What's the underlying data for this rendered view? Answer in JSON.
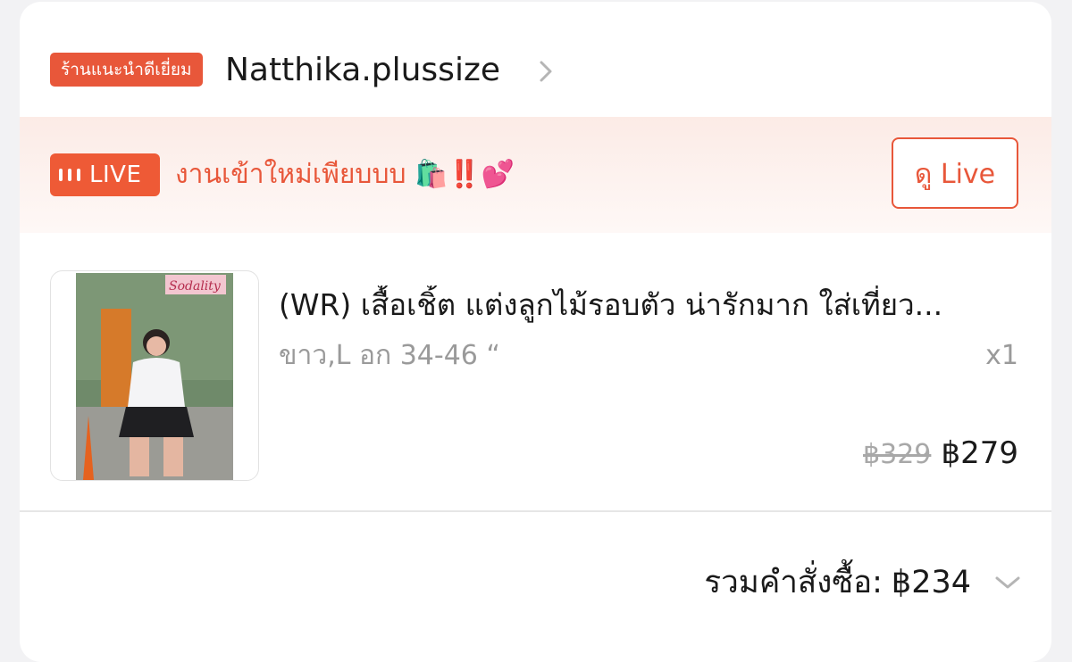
{
  "shop": {
    "badge": "ร้านแนะนำดีเยี่ยม",
    "name": "Natthika.plussize"
  },
  "live": {
    "badge_label": "LIVE",
    "caption": "งานเข้าใหม่เพียบบบ 🛍️‼️💕",
    "watch_button": "ดู Live"
  },
  "product": {
    "title": "(WR) เสื้อเชิ้ต แต่งลูกไม้รอบตัว น่ารักมาก ใส่เที่ยว...",
    "variant": "ขาว,L อก 34-46 “",
    "quantity": "x1",
    "original_price": "฿329",
    "price": "฿279",
    "image_sign_text": "Sodality"
  },
  "order": {
    "total_label": "รวมคำสั่งซื้อ:",
    "total_value": "฿234"
  },
  "colors": {
    "accent": "#e8573a",
    "live_badge": "#ee5a36",
    "banner_bg": "#fcebe6",
    "muted_text": "#9a9a9a"
  },
  "icons": [
    "chevron-right-icon",
    "live-bars-icon",
    "chevron-down-icon"
  ]
}
